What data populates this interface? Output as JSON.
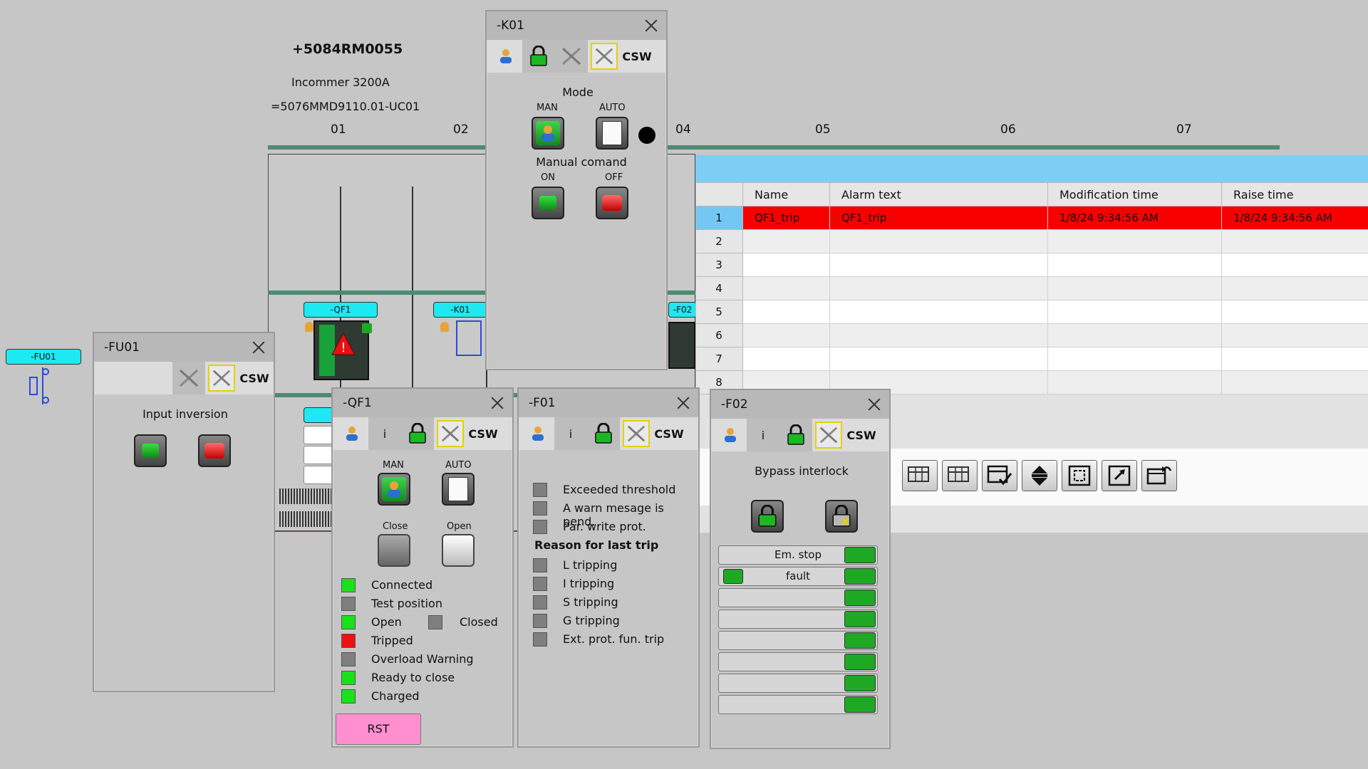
{
  "header": {
    "cabinet_id": "+5084RM0055",
    "cabinet_desc": "Incommer 3200A",
    "cabinet_ref": "=5076MMD9110.01-UC01",
    "columns": [
      "01",
      "02",
      "04",
      "05",
      "06",
      "07"
    ]
  },
  "schematic": {
    "fu01_tag": "-FU01",
    "qf1_tag": "-QF1",
    "k01_tag": "-K01",
    "f02_tag": "-F02"
  },
  "alarm_table": {
    "headers": {
      "row": "",
      "name": "Name",
      "alarm_text": "Alarm text",
      "mod_time": "Modification time",
      "raise_time": "Raise time"
    },
    "rows": [
      {
        "n": "1",
        "name": "QF1_trip",
        "text": "QF1_trip",
        "mod": "1/8/24 9:34:56 AM",
        "raise": "1/8/24 9:34:56 AM"
      },
      {
        "n": "2",
        "name": "",
        "text": "",
        "mod": "",
        "raise": ""
      },
      {
        "n": "3",
        "name": "",
        "text": "",
        "mod": "",
        "raise": ""
      },
      {
        "n": "4",
        "name": "",
        "text": "",
        "mod": "",
        "raise": ""
      },
      {
        "n": "5",
        "name": "",
        "text": "",
        "mod": "",
        "raise": ""
      },
      {
        "n": "6",
        "name": "",
        "text": "",
        "mod": "",
        "raise": ""
      },
      {
        "n": "7",
        "name": "",
        "text": "",
        "mod": "",
        "raise": ""
      },
      {
        "n": "8",
        "name": "",
        "text": "",
        "mod": "",
        "raise": ""
      }
    ]
  },
  "k01": {
    "title": "-K01",
    "csw": "CSW",
    "mode_label": "Mode",
    "man_label": "MAN",
    "auto_label": "AUTO",
    "manual_label": "Manual comand",
    "on_label": "ON",
    "off_label": "OFF"
  },
  "fu01": {
    "title": "-FU01",
    "csw": "CSW",
    "input_inversion": "Input inversion"
  },
  "qf1": {
    "title": "-QF1",
    "info": "i",
    "csw": "CSW",
    "man_label": "MAN",
    "auto_label": "AUTO",
    "close_label": "Close",
    "open_label": "Open",
    "indicators": {
      "connected": "Connected",
      "test_position": "Test position",
      "open": "Open",
      "closed": "Closed",
      "tripped": "Tripped",
      "overload_warning": "Overload Warning",
      "ready_to_close": "Ready to close",
      "charged": "Charged"
    },
    "rst_label": "RST"
  },
  "f01": {
    "title": "-F01",
    "info": "i",
    "csw": "CSW",
    "exceeded": "Exceeded threshold",
    "warn": "A warn mesage is pend.",
    "par_write": "Par. write prot.",
    "reason_header": "Reason for last trip",
    "l_trip": "L tripping",
    "i_trip": "I tripping",
    "s_trip": "S tripping",
    "g_trip": "G tripping",
    "ext_trip": "Ext. prot. fun. trip"
  },
  "f02": {
    "title": "-F02",
    "info": "i",
    "csw": "CSW",
    "bypass_label": "Bypass interlock",
    "slots": [
      "Em. stop",
      "fault",
      "",
      "",
      "",
      "",
      "",
      ""
    ]
  },
  "colors": {
    "green": "#19e219",
    "red": "#f01010",
    "grey": "#7f7f7f",
    "accent_blue": "#7ecdf4",
    "tag_cyan": "#1de9f2",
    "rst_pink": "#ff8fce"
  }
}
